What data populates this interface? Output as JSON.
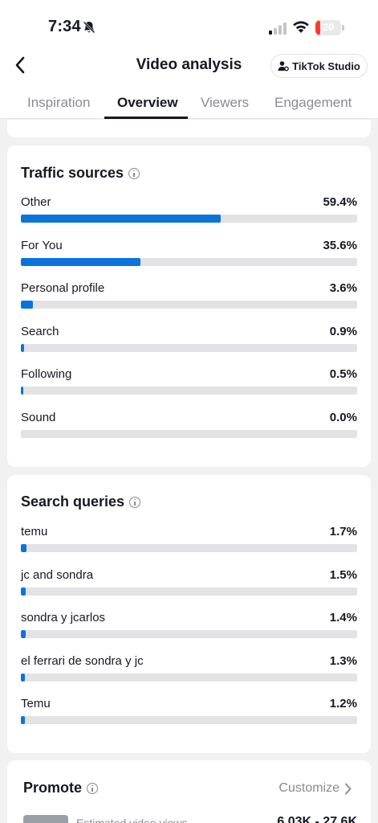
{
  "status": {
    "time": "7:34",
    "battery": "20",
    "battery_level": 0.2
  },
  "header": {
    "title": "Video analysis",
    "studio_label": "TikTok Studio"
  },
  "tabs": [
    {
      "label": "Inspiration",
      "active": false
    },
    {
      "label": "Overview",
      "active": true
    },
    {
      "label": "Viewers",
      "active": false
    },
    {
      "label": "Engagement",
      "active": false
    }
  ],
  "traffic": {
    "title": "Traffic sources",
    "items": [
      {
        "label": "Other",
        "value": "59.4%",
        "pct": 59.4
      },
      {
        "label": "For You",
        "value": "35.6%",
        "pct": 35.6
      },
      {
        "label": "Personal profile",
        "value": "3.6%",
        "pct": 3.6
      },
      {
        "label": "Search",
        "value": "0.9%",
        "pct": 0.9
      },
      {
        "label": "Following",
        "value": "0.5%",
        "pct": 0.5
      },
      {
        "label": "Sound",
        "value": "0.0%",
        "pct": 0.0
      }
    ]
  },
  "search": {
    "title": "Search queries",
    "items": [
      {
        "label": "temu",
        "value": "1.7%",
        "pct": 1.7
      },
      {
        "label": "jc and sondra",
        "value": "1.5%",
        "pct": 1.5
      },
      {
        "label": "sondra y jcarlos",
        "value": "1.4%",
        "pct": 1.4
      },
      {
        "label": "el ferrari de sondra y jc",
        "value": "1.3%",
        "pct": 1.3
      },
      {
        "label": "Temu",
        "value": "1.2%",
        "pct": 1.2
      }
    ]
  },
  "promote": {
    "title": "Promote",
    "customize_label": "Customize",
    "estimated_label": "Estimated video views",
    "estimated_value": "6.03K - 27.6K"
  },
  "colors": {
    "accent": "#0a74da",
    "track": "#e3e3e5",
    "battery": "#ff3b30"
  }
}
